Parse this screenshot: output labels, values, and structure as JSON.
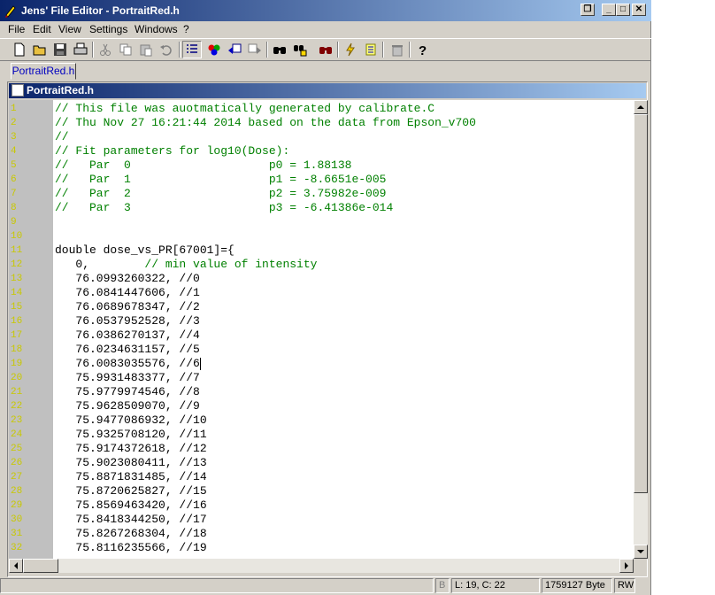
{
  "window": {
    "title": "Jens' File Editor - PortraitRed.h"
  },
  "menu": [
    {
      "label": "File",
      "key": "file"
    },
    {
      "label": "Edit",
      "key": "edit"
    },
    {
      "label": "View",
      "key": "view"
    },
    {
      "label": "Settings",
      "key": "settings"
    },
    {
      "label": "Windows",
      "key": "windows"
    },
    {
      "label": "?",
      "key": "help"
    }
  ],
  "toolbar_icons": [
    "new-file-icon",
    "open-folder-icon",
    "save-icon",
    "print-icon",
    "cut-icon",
    "copy-icon",
    "paste-icon",
    "undo-icon",
    "line-numbers-icon",
    "syntax-colors-icon",
    "previous-file-icon",
    "next-file-icon",
    "find-icon",
    "find-replace-icon",
    "find-in-files-icon",
    "goto-line-icon",
    "bookmark-icon",
    "delete-icon",
    "help-icon"
  ],
  "tab": {
    "label": "PortraitRed.h"
  },
  "document": {
    "title": "PortraitRed.h"
  },
  "editor": {
    "lines": [
      {
        "n": "1",
        "code": "",
        "comment": "// This file was auotmatically generated by calibrate.C"
      },
      {
        "n": "2",
        "code": "",
        "comment": "// Thu Nov 27 16:21:44 2014 based on the data from Epson_v700"
      },
      {
        "n": "3",
        "code": "",
        "comment": "//"
      },
      {
        "n": "4",
        "code": "",
        "comment": "// Fit parameters for log10(Dose):"
      },
      {
        "n": "5",
        "code": "",
        "comment": "//   Par  0                    p0 = 1.88138"
      },
      {
        "n": "6",
        "code": "",
        "comment": "//   Par  1                    p1 = -8.6651e-005"
      },
      {
        "n": "7",
        "code": "",
        "comment": "//   Par  2                    p2 = 3.75982e-009"
      },
      {
        "n": "8",
        "code": "",
        "comment": "//   Par  3                    p3 = -6.41386e-014"
      },
      {
        "n": "9",
        "code": "",
        "comment": ""
      },
      {
        "n": "10",
        "code": "",
        "comment": ""
      },
      {
        "n": "11",
        "code": "double dose_vs_PR[67001]={",
        "comment": ""
      },
      {
        "n": "12",
        "code": "   0,        ",
        "comment": "// min value of intensity"
      },
      {
        "n": "13",
        "code": "   76.0993260322, //0",
        "comment": ""
      },
      {
        "n": "14",
        "code": "   76.0841447606, //1",
        "comment": ""
      },
      {
        "n": "15",
        "code": "   76.0689678347, //2",
        "comment": ""
      },
      {
        "n": "16",
        "code": "   76.0537952528, //3",
        "comment": ""
      },
      {
        "n": "17",
        "code": "   76.0386270137, //4",
        "comment": ""
      },
      {
        "n": "18",
        "code": "   76.0234631157, //5",
        "comment": ""
      },
      {
        "n": "19",
        "code": "   76.0083035576, //6",
        "comment": ""
      },
      {
        "n": "20",
        "code": "   75.9931483377, //7",
        "comment": ""
      },
      {
        "n": "21",
        "code": "   75.9779974546, //8",
        "comment": ""
      },
      {
        "n": "22",
        "code": "   75.9628509070, //9",
        "comment": ""
      },
      {
        "n": "23",
        "code": "   75.9477086932, //10",
        "comment": ""
      },
      {
        "n": "24",
        "code": "   75.9325708120, //11",
        "comment": ""
      },
      {
        "n": "25",
        "code": "   75.9174372618, //12",
        "comment": ""
      },
      {
        "n": "26",
        "code": "   75.9023080411, //13",
        "comment": ""
      },
      {
        "n": "27",
        "code": "   75.8871831485, //14",
        "comment": ""
      },
      {
        "n": "28",
        "code": "   75.8720625827, //15",
        "comment": ""
      },
      {
        "n": "29",
        "code": "   75.8569463420, //16",
        "comment": ""
      },
      {
        "n": "30",
        "code": "   75.8418344250, //17",
        "comment": ""
      },
      {
        "n": "31",
        "code": "   75.8267268304, //18",
        "comment": ""
      },
      {
        "n": "32",
        "code": "   75.8116235566, //19",
        "comment": ""
      }
    ],
    "caret_line": "19"
  },
  "status": {
    "mode_indicator": "B",
    "position": "L: 19, C: 22",
    "size": "1759127 Byte",
    "access": "RW"
  },
  "colors": {
    "comment": "#008000",
    "line_number": "#c8c800",
    "gutter": "#c0c0c0",
    "title_start": "#0a246a",
    "title_end": "#a6caf0"
  }
}
